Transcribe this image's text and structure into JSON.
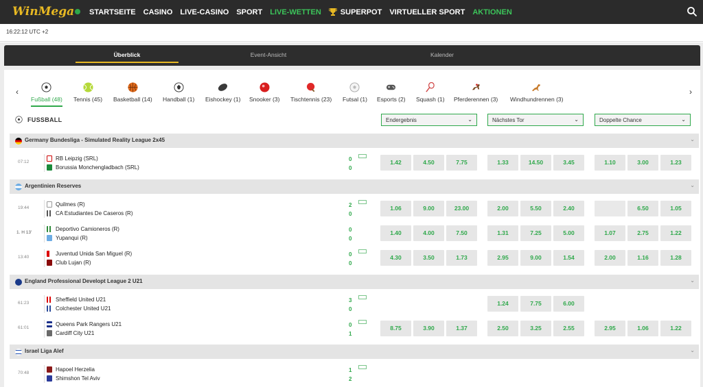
{
  "logo": "WinMega",
  "nav": [
    "STARTSEITE",
    "CASINO",
    "LIVE-CASINO",
    "SPORT",
    "LIVE-WETTEN",
    "SUPERPOT",
    "VIRTUELLER SPORT",
    "AKTIONEN"
  ],
  "clock": "16:22:12 UTC +2",
  "tabs": [
    "Überblick",
    "Event-Ansicht",
    "Kalender"
  ],
  "sports": [
    {
      "label": "Fußball (48)",
      "icon": "soccer-ball-icon"
    },
    {
      "label": "Tennis (45)",
      "icon": "tennis-ball-icon"
    },
    {
      "label": "Basketball (14)",
      "icon": "basketball-icon"
    },
    {
      "label": "Handball (1)",
      "icon": "handball-icon"
    },
    {
      "label": "Eishockey (1)",
      "icon": "hockey-puck-icon"
    },
    {
      "label": "Snooker (3)",
      "icon": "snooker-ball-icon"
    },
    {
      "label": "Tischtennis (23)",
      "icon": "table-tennis-icon"
    },
    {
      "label": "Futsal (1)",
      "icon": "futsal-ball-icon"
    },
    {
      "label": "Esports (2)",
      "icon": "gamepad-icon"
    },
    {
      "label": "Squash (1)",
      "icon": "squash-racket-icon"
    },
    {
      "label": "Pferderennen (3)",
      "icon": "horse-racing-icon"
    },
    {
      "label": "Windhundrennen (3)",
      "icon": "greyhound-icon"
    }
  ],
  "section_title": "FUSSBALL",
  "markets": [
    "Endergebnis",
    "Nächstes Tor",
    "Doppelte Chance"
  ],
  "leagues": [
    {
      "name": "Germany Bundesliga - Simulated Reality League 2x45",
      "matches": [
        {
          "time": "07:12",
          "home": "RB Leipzig (SRL)",
          "away": "Borussia Monchengladbach (SRL)",
          "score_home": "0",
          "score_away": "0",
          "odds": [
            "1.42",
            "4.50",
            "7.75",
            "1.33",
            "14.50",
            "3.45",
            "1.10",
            "3.00",
            "1.23"
          ]
        }
      ]
    },
    {
      "name": "Argentinien Reserves",
      "matches": [
        {
          "time": "19:44",
          "home": "Quilmes (R)",
          "away": "CA Estudiantes De Caseros (R)",
          "score_home": "2",
          "score_away": "0",
          "odds": [
            "1.06",
            "9.00",
            "23.00",
            "2.00",
            "5.50",
            "2.40",
            "",
            "6.50",
            "1.05"
          ]
        },
        {
          "time": "1. H 13'",
          "home": "Deportivo Camioneros (R)",
          "away": "Yupanqui (R)",
          "score_home": "0",
          "score_away": "0",
          "odds": [
            "1.40",
            "4.00",
            "7.50",
            "1.31",
            "7.25",
            "5.00",
            "1.07",
            "2.75",
            "1.22"
          ]
        },
        {
          "time": "13:40",
          "home": "Juventud Unida San Miguel (R)",
          "away": "Club Lujan (R)",
          "score_home": "0",
          "score_away": "0",
          "odds": [
            "4.30",
            "3.50",
            "1.73",
            "2.95",
            "9.00",
            "1.54",
            "2.00",
            "1.16",
            "1.28"
          ]
        }
      ]
    },
    {
      "name": "England Professional Developt League 2 U21",
      "matches": [
        {
          "time": "61:23",
          "home": "Sheffield United U21",
          "away": "Colchester United U21",
          "score_home": "3",
          "score_away": "0",
          "odds": [
            "",
            "",
            "",
            "1.24",
            "7.75",
            "6.00",
            "",
            "",
            ""
          ]
        },
        {
          "time": "61:01",
          "home": "Queens Park Rangers U21",
          "away": "Cardiff City U21",
          "score_home": "0",
          "score_away": "1",
          "odds": [
            "8.75",
            "3.90",
            "1.37",
            "2.50",
            "3.25",
            "2.55",
            "2.95",
            "1.06",
            "1.22"
          ]
        }
      ]
    },
    {
      "name": "Israel Liga Alef",
      "matches": [
        {
          "time": "70:48",
          "home": "Hapoel Herzelia",
          "away": "Shimshon Tel Aviv",
          "score_home": "1",
          "score_away": "2",
          "odds": [
            "",
            "",
            "",
            "",
            "",
            "",
            "",
            "",
            ""
          ]
        }
      ]
    }
  ],
  "colors": {
    "accent_green": "#2ea84a",
    "nav_bg": "#2b2b2b",
    "gold": "#e8b923"
  }
}
